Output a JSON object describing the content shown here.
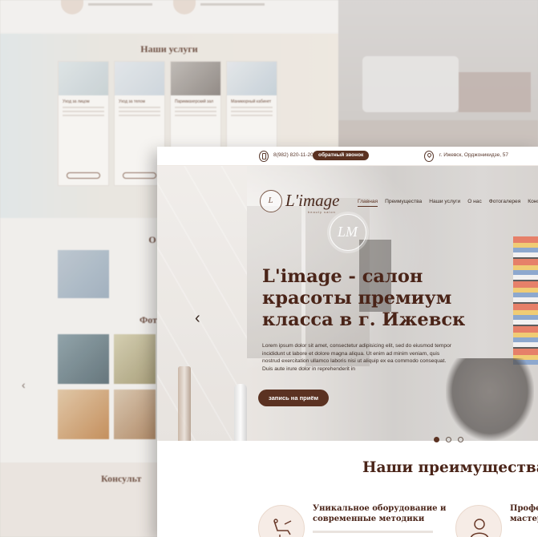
{
  "background_page": {
    "services_title": "Наши услуги",
    "partial_heading_1": "О",
    "partial_heading_2": "Фот",
    "partial_heading_3": "Консульт",
    "service_cards": [
      {
        "title": "Уход за лицом"
      },
      {
        "title": "Уход за телом"
      },
      {
        "title": "Парикмахерский зал"
      },
      {
        "title": "Маникюрный кабинет"
      }
    ],
    "prev_arrow": "‹"
  },
  "topbar": {
    "phone": "8(982) 820-11-20",
    "callback_label": "обратный звонок",
    "address": "г. Ижевск, Орджоникидзе, 57"
  },
  "logo": {
    "emblem": "L",
    "name": "L'image",
    "tagline": "beauty salon"
  },
  "nav": {
    "items": [
      "Главная",
      "Преимущества",
      "Наши услуги",
      "О нас",
      "Фотогалерея",
      "Консульт"
    ],
    "active_index": 0
  },
  "hero": {
    "monogram": "LM",
    "title": "L'image - салон красоты премиум класса в г. Ижевск",
    "text": "Lorem ipsum dolor sit amet, consectetur adipisicing elit, sed do eiusmod tempor incididunt ut labore et dolore magna aliqua. Ut enim ad minim veniam, quis nostrud exercitation ullamco laboris nisi ut aliquip ex ea commodo consequat. Duis aute irure dolor in reprehenderit in",
    "cta_label": "запись на приём",
    "prev_arrow": "‹",
    "slides_count": 3,
    "active_slide": 1
  },
  "advantages": {
    "title": "Наши преимущества",
    "items": [
      {
        "title": "Уникальное оборудование и современные методики",
        "icon": "dental-chair-icon"
      },
      {
        "title": "Профессиональные мастера",
        "icon": "master-icon"
      }
    ]
  },
  "colors": {
    "brand": "#5b3222",
    "heading": "#4a2418",
    "accent_bg": "#f6ece6"
  }
}
